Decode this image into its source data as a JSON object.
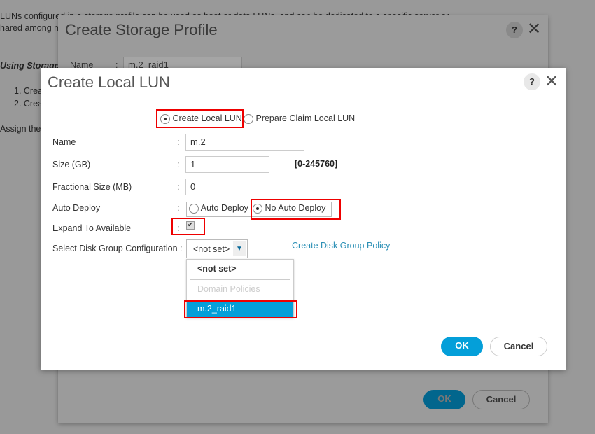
{
  "background": {
    "lines": [
      "LUNs configured in a storage profile can be used as boot or data LUNs, and can be dedicated to a specific server or",
      "hared among m",
      "Using Storage",
      "1. Crea",
      "2. Crea",
      "Assign the s"
    ]
  },
  "outer_dialog": {
    "title": "Create Storage Profile",
    "help": "?",
    "name_label": "Name",
    "colon": ":",
    "name_value": "m.2_raid1",
    "ok": "OK",
    "cancel": "Cancel"
  },
  "dialog": {
    "title": "Create Local LUN",
    "help": "?",
    "mode_options": [
      "Create Local LUN",
      "Prepare Claim Local LUN"
    ],
    "mode_selected": "Create Local LUN",
    "colon": ":",
    "name_label": "Name",
    "name_value": "m.2",
    "size_label": "Size (GB)",
    "size_value": "1",
    "size_range": "[0-245760]",
    "frac_label": "Fractional Size (MB)",
    "frac_value": "0",
    "auto_label": "Auto Deploy",
    "auto_options": [
      "Auto Deploy",
      "No Auto Deploy"
    ],
    "auto_selected": "No Auto Deploy",
    "expand_label": "Expand To Available",
    "expand_checked": true,
    "disk_label": "Select Disk Group Configuration :",
    "disk_value": "<not set>",
    "disk_options": {
      "first": "<not set>",
      "group": "Domain Policies",
      "items": [
        "m.2_raid1"
      ]
    },
    "disk_highlighted": "m.2_raid1",
    "create_policy_link": "Create Disk Group Policy",
    "ok": "OK",
    "cancel": "Cancel"
  },
  "colors": {
    "accent": "#049fd9",
    "highlight": "#e00000",
    "link": "#2a8fb5"
  }
}
